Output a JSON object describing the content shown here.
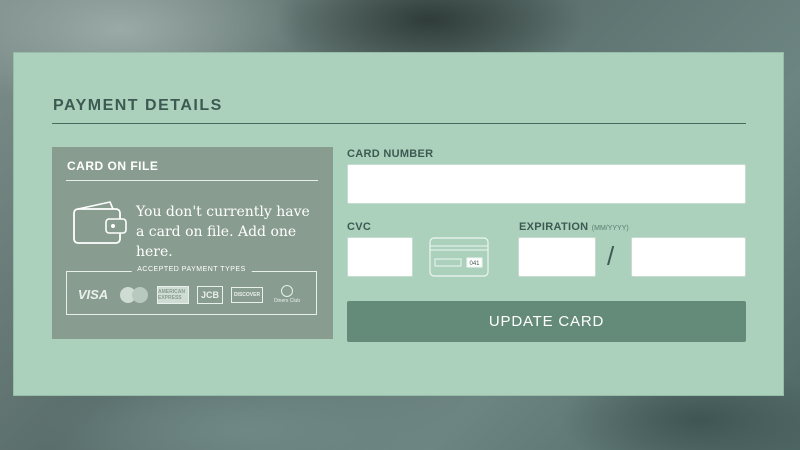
{
  "form": {
    "title": "PAYMENT DETAILS",
    "card_on_file": {
      "heading": "CARD ON FILE",
      "message": "You don't currently have a card on file. Add one here.",
      "accepted_label": "ACCEPTED PAYMENT TYPES",
      "logos": [
        {
          "name": "visa-icon",
          "text": "VISA"
        },
        {
          "name": "mastercard-icon",
          "text": "MasterCard"
        },
        {
          "name": "amex-icon",
          "text": "AMERICAN EXPRESS"
        },
        {
          "name": "jcb-icon",
          "text": "JCB"
        },
        {
          "name": "discover-icon",
          "text": "DISCOVER"
        },
        {
          "name": "diners-club-icon",
          "text": "Diners Club"
        }
      ]
    },
    "card_number": {
      "label": "CARD NUMBER",
      "value": "",
      "placeholder": ""
    },
    "cvc": {
      "label": "CVC",
      "value": "",
      "placeholder": "",
      "hint_digits": "041"
    },
    "expiration": {
      "label": "EXPIRATION",
      "format_hint": "(MM/YYYY)",
      "separator": "/",
      "month_value": "",
      "year_value": ""
    },
    "submit_label": "UPDATE CARD"
  },
  "colors": {
    "panel": "#abd1bd",
    "card_on_file_bg": "#889c8f",
    "button": "#648b7a",
    "text": "#3d5a52"
  }
}
